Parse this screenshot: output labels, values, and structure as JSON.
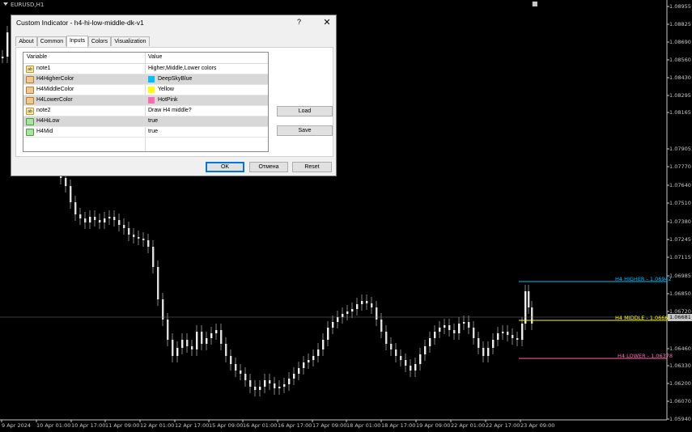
{
  "chart": {
    "symbol": "EURUSD,H1",
    "price_labels": [
      "1.08955",
      "1.08825",
      "1.08690",
      "1.08560",
      "1.08430",
      "1.08295",
      "1.08165",
      "1.07905",
      "1.07770",
      "1.07640",
      "1.07510",
      "1.07380",
      "1.07245",
      "1.07115",
      "1.06985",
      "1.06850",
      "1.06720",
      "1.06460",
      "1.06330",
      "1.06200",
      "1.06070",
      "1.05940"
    ],
    "time_labels": [
      "9 Apr 2024",
      "10 Apr 01:00",
      "10 Apr 17:00",
      "11 Apr 09:00",
      "12 Apr 01:00",
      "12 Apr 17:00",
      "15 Apr 09:00",
      "16 Apr 01:00",
      "16 Apr 17:00",
      "17 Apr 09:00",
      "18 Apr 01:00",
      "18 Apr 17:00",
      "19 Apr 09:00",
      "22 Apr 01:00",
      "22 Apr 17:00",
      "23 Apr 09:00"
    ],
    "current_price": "1.06681",
    "levels": {
      "higher": {
        "label": "H4 HIGHER - 1.06942",
        "color": "#00bfff"
      },
      "middle": {
        "label": "H4 MIDDLE - 1.06660",
        "color": "#ffff00"
      },
      "lower": {
        "label": "H4 LOWER - 1.06378",
        "color": "#ff69b4"
      }
    },
    "mini_controls": [
      "▼",
      "■",
      "✕"
    ]
  },
  "dialog": {
    "title": "Custom Indicator - h4-hi-low-middle-dk-v1",
    "help": "?",
    "close": "✕",
    "tabs": [
      "About",
      "Common",
      "Inputs",
      "Colors",
      "Visualization"
    ],
    "active_tab": "Inputs",
    "columns": {
      "variable": "Variable",
      "value": "Value"
    },
    "rows": [
      {
        "icon": "ab",
        "icon_text": "ab",
        "variable": "note1",
        "value": "Higher,Middle,Lower colors"
      },
      {
        "icon": "cl",
        "icon_text": "",
        "variable": "H4HigherColor",
        "value": "DeepSkyBlue",
        "swatch": "#00bfff"
      },
      {
        "icon": "cl",
        "icon_text": "",
        "variable": "H4MiddleColor",
        "value": "Yellow",
        "swatch": "#ffff00"
      },
      {
        "icon": "cl",
        "icon_text": "",
        "variable": "H4LowerColor",
        "value": "HotPink",
        "swatch": "#ff69b4"
      },
      {
        "icon": "ab",
        "icon_text": "ab",
        "variable": "note2",
        "value": "Draw H4 middle?"
      },
      {
        "icon": "bl",
        "icon_text": "",
        "variable": "H4HiLow",
        "value": "true"
      },
      {
        "icon": "bl",
        "icon_text": "",
        "variable": "H4Mid",
        "value": "true"
      }
    ],
    "buttons": {
      "load": "Load",
      "save": "Save",
      "ok": "OK",
      "cancel": "Отмена",
      "reset": "Reset"
    }
  }
}
